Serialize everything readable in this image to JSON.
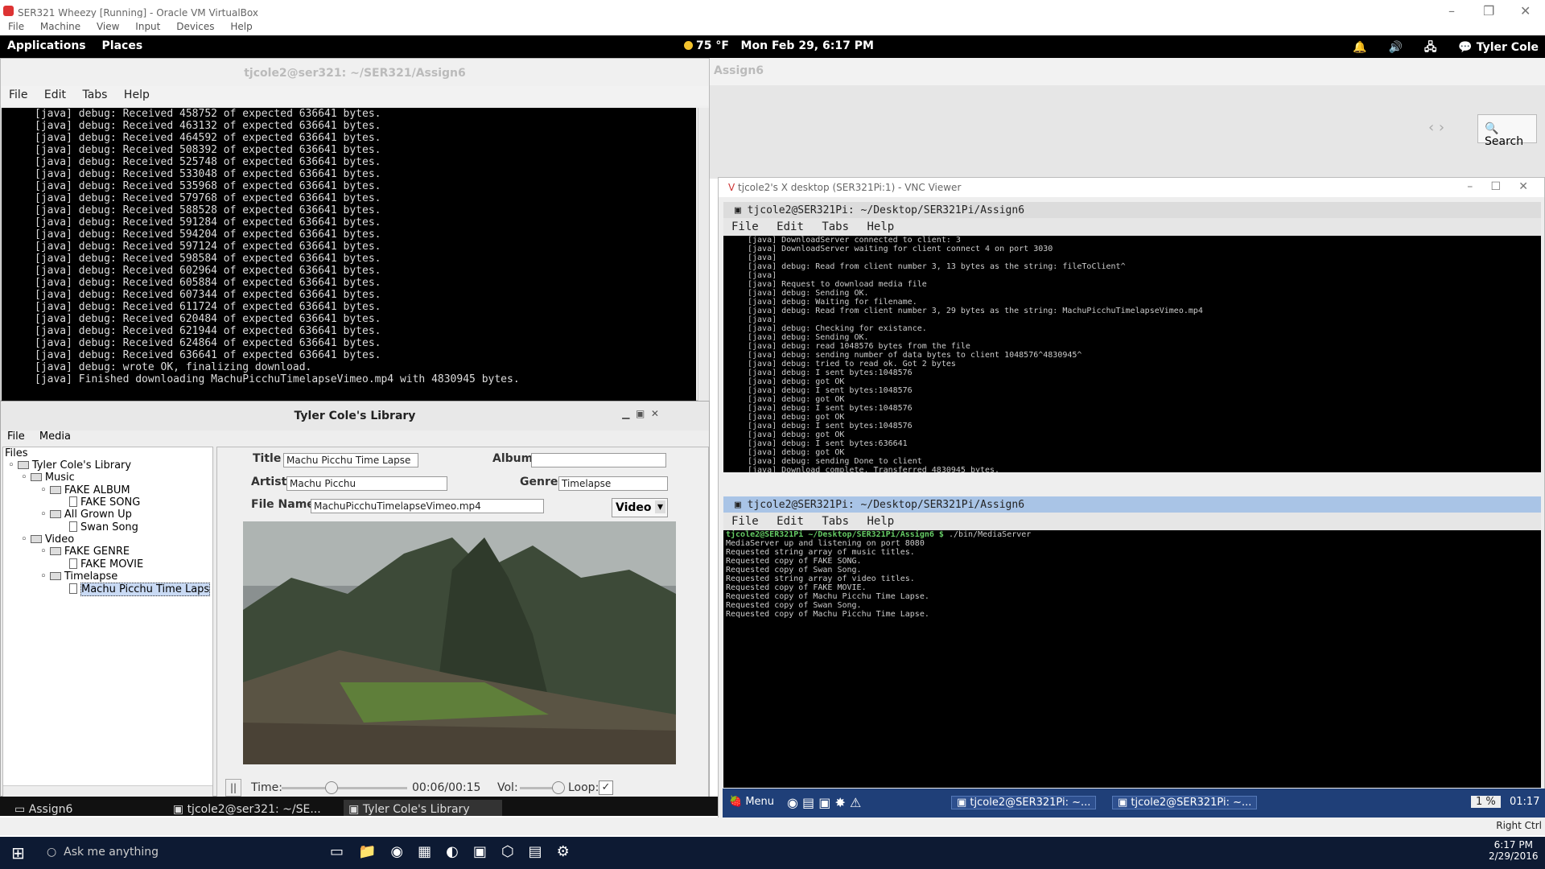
{
  "vbox": {
    "title": "SER321 Wheezy [Running] - Oracle VM VirtualBox",
    "menu": [
      "File",
      "Machine",
      "View",
      "Input",
      "Devices",
      "Help"
    ]
  },
  "panel": {
    "apps": "Applications",
    "places": "Places",
    "weather": "75 °F",
    "clock": "Mon Feb 29,  6:17 PM",
    "user": "Tyler Cole"
  },
  "term_left": {
    "title": "tjcole2@ser321: ~/SER321/Assign6",
    "menu": [
      "File",
      "Edit",
      "Tabs",
      "Help"
    ],
    "lines": [
      "[java] debug: Received 458752 of expected 636641 bytes.",
      "[java] debug: Received 463132 of expected 636641 bytes.",
      "[java] debug: Received 464592 of expected 636641 bytes.",
      "[java] debug: Received 508392 of expected 636641 bytes.",
      "[java] debug: Received 525748 of expected 636641 bytes.",
      "[java] debug: Received 533048 of expected 636641 bytes.",
      "[java] debug: Received 535968 of expected 636641 bytes.",
      "[java] debug: Received 579768 of expected 636641 bytes.",
      "[java] debug: Received 588528 of expected 636641 bytes.",
      "[java] debug: Received 591284 of expected 636641 bytes.",
      "[java] debug: Received 594204 of expected 636641 bytes.",
      "[java] debug: Received 597124 of expected 636641 bytes.",
      "[java] debug: Received 598584 of expected 636641 bytes.",
      "[java] debug: Received 602964 of expected 636641 bytes.",
      "[java] debug: Received 605884 of expected 636641 bytes.",
      "[java] debug: Received 607344 of expected 636641 bytes.",
      "[java] debug: Received 611724 of expected 636641 bytes.",
      "[java] debug: Received 620484 of expected 636641 bytes.",
      "[java] debug: Received 621944 of expected 636641 bytes.",
      "[java] debug: Received 624864 of expected 636641 bytes.",
      "[java] debug: Received 636641 of expected 636641 bytes.",
      "[java] debug: wrote OK, finalizing download.",
      "[java] Finished downloading MachuPicchuTimelapseVimeo.mp4 with 4830945 bytes."
    ]
  },
  "library": {
    "title": "Tyler Cole's Library",
    "menu": [
      "File",
      "Media"
    ],
    "files_label": "Files",
    "tree": [
      "Tyler Cole's Library",
      "Music",
      "FAKE ALBUM",
      "FAKE SONG",
      "All Grown Up",
      "Swan Song",
      "Video",
      "FAKE GENRE",
      "FAKE MOVIE",
      "Timelapse",
      "Machu Picchu Time Laps"
    ],
    "labels": {
      "title": "Title",
      "album": "Album",
      "artist": "Artist",
      "genre": "Genre",
      "filename": "File Name",
      "time": "Time:",
      "vol": "Vol:",
      "loop": "Loop:"
    },
    "values": {
      "title": "Machu Picchu Time Lapse",
      "album": "",
      "artist": "Machu Picchu",
      "genre": "Timelapse",
      "filename": "MachuPicchuTimelapseVimeo.mp4",
      "type": "Video",
      "time": "00:06/00:15",
      "time_progress": 0.4,
      "volume": 1.0,
      "loop_checked": true
    }
  },
  "nautilus": {
    "title": "Assign6",
    "search": "Search"
  },
  "vnc": {
    "title": "tjcole2's X desktop (SER321Pi:1) - VNC Viewer",
    "term1": {
      "title": "tjcole2@SER321Pi: ~/Desktop/SER321Pi/Assign6",
      "menu": [
        "File",
        "Edit",
        "Tabs",
        "Help"
      ],
      "lines": [
        "[java] DownloadServer connected to client: 3",
        "[java] DownloadServer waiting for client connect 4 on port 3030",
        "[java]",
        "[java] debug: Read from client number 3, 13 bytes as the string: fileToClient^",
        "[java]",
        "[java] Request to download media file",
        "[java] debug: Sending OK.",
        "[java] debug: Waiting for filename.",
        "[java] debug: Read from client number 3, 29 bytes as the string: MachuPicchuTimelapseVimeo.mp4",
        "[java]",
        "[java] debug: Checking for existance.",
        "[java] debug: Sending OK.",
        "[java] debug: read 1048576 bytes from the file",
        "[java] debug: sending number of data bytes to client 1048576^4830945^",
        "[java] debug: tried to read ok. Got 2 bytes",
        "[java] debug: I sent bytes:1048576",
        "[java] debug: got OK",
        "[java] debug: I sent bytes:1048576",
        "[java] debug: got OK",
        "[java] debug: I sent bytes:1048576",
        "[java] debug: got OK",
        "[java] debug: I sent bytes:1048576",
        "[java] debug: got OK",
        "[java] debug: I sent bytes:636641",
        "[java] debug: got OK",
        "[java] debug: sending Done to client",
        "[java] Download complete. Transferred 4830945 bytes."
      ]
    },
    "term2": {
      "title": "tjcole2@SER321Pi: ~/Desktop/SER321Pi/Assign6",
      "menu": [
        "File",
        "Edit",
        "Tabs",
        "Help"
      ],
      "prompt": "tjcole2@SER321Pi ~/Desktop/SER321Pi/Assign6 $",
      "command": " ./bin/MediaServer",
      "lines": [
        "MediaServer up and listening on port 8080",
        "Requested string array of music titles.",
        "Requested copy of FAKE SONG.",
        "Requested copy of Swan Song.",
        "Requested string array of video titles.",
        "Requested copy of FAKE MOVIE.",
        "Requested copy of Machu Picchu Time Lapse.",
        "Requested copy of Swan Song.",
        "Requested copy of Machu Picchu Time Lapse."
      ]
    },
    "taskbar": {
      "menu": "Menu",
      "task1": "tjcole2@SER321Pi: ~...",
      "task2": "tjcole2@SER321Pi: ~...",
      "cpu": "1 %",
      "clock": "01:17"
    }
  },
  "linux_taskbar": {
    "items": [
      "Assign6",
      "tjcole2@ser321: ~/SE...",
      "Tyler Cole's Library"
    ]
  },
  "vb_status": {
    "host_key": "Right Ctrl"
  },
  "win": {
    "search": "Ask me anything",
    "time": "6:17 PM",
    "date": "2/29/2016"
  },
  "colors": {
    "accent": "#1f3f78",
    "term_bg": "#000000"
  }
}
